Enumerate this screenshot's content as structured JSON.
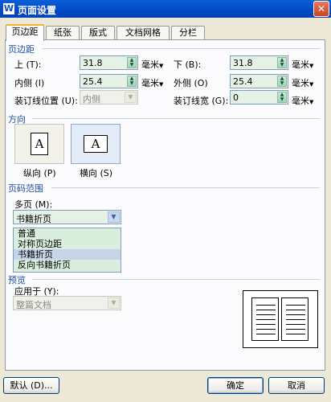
{
  "window": {
    "title": "页面设置",
    "app_icon": "W"
  },
  "tabs": [
    {
      "label": "页边距",
      "active": true
    },
    {
      "label": "纸张"
    },
    {
      "label": "版式"
    },
    {
      "label": "文档网格"
    },
    {
      "label": "分栏"
    }
  ],
  "margins": {
    "title": "页边距",
    "top_label": "上 (T):",
    "top_value": "31.8",
    "bottom_label": "下 (B):",
    "bottom_value": "31.8",
    "inner_label": "内侧 (I)",
    "inner_value": "25.4",
    "outer_label": "外侧 (O)",
    "outer_value": "25.4",
    "gutter_pos_label": "装订线位置 (U):",
    "gutter_pos_value": "内侧",
    "gutter_label": "装订线宽 (G):",
    "gutter_value": "0",
    "unit": "毫米"
  },
  "orientation": {
    "title": "方向",
    "portrait_label": "纵向 (P)",
    "landscape_label": "横向 (S)",
    "glyph": "A"
  },
  "pages": {
    "title": "页码范围",
    "multi_label": "多页 (M):",
    "multi_value": "书籍折页",
    "options": [
      "普通",
      "对称页边距",
      "书籍折页",
      "反向书籍折页"
    ],
    "selected_index": 2
  },
  "preview": {
    "title": "预览",
    "apply_label": "应用于 (Y):",
    "apply_value": "整篇文档"
  },
  "buttons": {
    "default": "默认 (D)...",
    "ok": "确定",
    "cancel": "取消"
  }
}
